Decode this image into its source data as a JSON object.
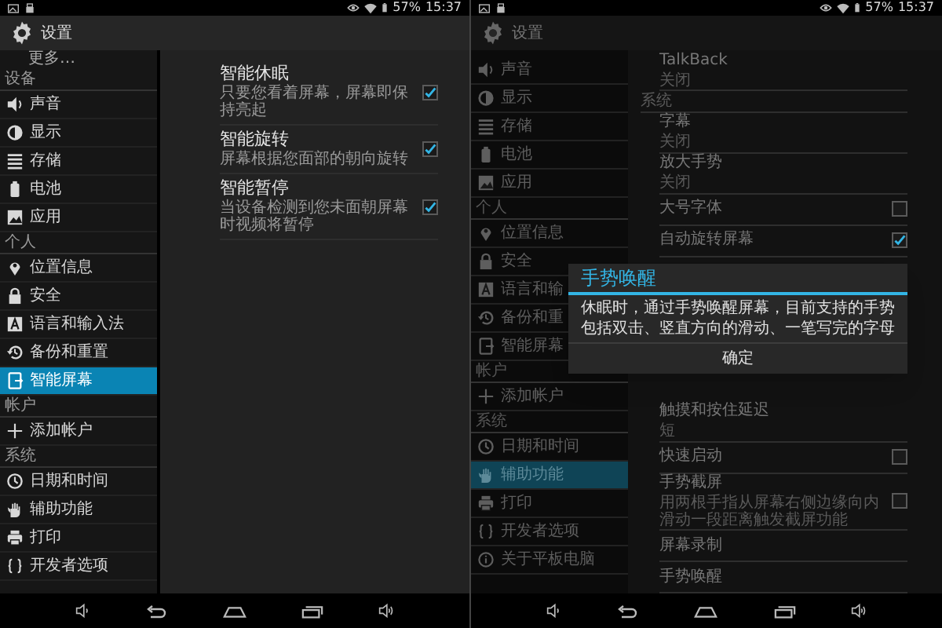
{
  "screens": [
    {
      "status_bar": {
        "battery": "57%",
        "time": "15:37"
      },
      "action_bar": {
        "title": "设置"
      },
      "sidebar": [
        {
          "kind": "cut",
          "label": "更多…"
        },
        {
          "kind": "header",
          "label": "设备"
        },
        {
          "kind": "item",
          "label": "声音",
          "selected": false
        },
        {
          "kind": "item",
          "label": "显示",
          "selected": false
        },
        {
          "kind": "item",
          "label": "存储",
          "selected": false
        },
        {
          "kind": "item",
          "label": "电池",
          "selected": false
        },
        {
          "kind": "item",
          "label": "应用",
          "selected": false
        },
        {
          "kind": "header",
          "label": "个人"
        },
        {
          "kind": "item",
          "label": "位置信息",
          "selected": false
        },
        {
          "kind": "item",
          "label": "安全",
          "selected": false
        },
        {
          "kind": "item",
          "label": "语言和输入法",
          "selected": false
        },
        {
          "kind": "item",
          "label": "备份和重置",
          "selected": false
        },
        {
          "kind": "item",
          "label": "智能屏幕",
          "selected": true
        },
        {
          "kind": "header",
          "label": "帐户"
        },
        {
          "kind": "item",
          "label": "添加帐户",
          "selected": false
        },
        {
          "kind": "header",
          "label": "系统"
        },
        {
          "kind": "item",
          "label": "日期和时间",
          "selected": false
        },
        {
          "kind": "item",
          "label": "辅助功能",
          "selected": false
        },
        {
          "kind": "item",
          "label": "打印",
          "selected": false
        },
        {
          "kind": "item",
          "label": "开发者选项",
          "selected": false
        }
      ],
      "content": {
        "rows": [
          {
            "kind": "checkbox",
            "title": "智能休眠",
            "subtitle": "只要您看着屏幕，屏幕即保持亮起",
            "checked": true
          },
          {
            "kind": "checkbox",
            "title": "智能旋转",
            "subtitle": "屏幕根据您面部的朝向旋转",
            "checked": true
          },
          {
            "kind": "checkbox",
            "title": "智能暂停",
            "subtitle": "当设备检测到您未面朝屏幕时视频将暂停",
            "checked": true
          }
        ]
      }
    },
    {
      "status_bar": {
        "battery": "57%",
        "time": "15:37"
      },
      "action_bar": {
        "title": "设置"
      },
      "sidebar": [
        {
          "kind": "item",
          "label": "声音",
          "selected": false
        },
        {
          "kind": "item",
          "label": "显示",
          "selected": false
        },
        {
          "kind": "item",
          "label": "存储",
          "selected": false
        },
        {
          "kind": "item",
          "label": "电池",
          "selected": false
        },
        {
          "kind": "item",
          "label": "应用",
          "selected": false
        },
        {
          "kind": "header",
          "label": "个人"
        },
        {
          "kind": "item",
          "label": "位置信息",
          "selected": false
        },
        {
          "kind": "item",
          "label": "安全",
          "selected": false
        },
        {
          "kind": "item",
          "label": "语言和输",
          "selected": false
        },
        {
          "kind": "item",
          "label": "备份和重",
          "selected": false
        },
        {
          "kind": "item",
          "label": "智能屏幕",
          "selected": false
        },
        {
          "kind": "header",
          "label": "帐户"
        },
        {
          "kind": "item",
          "label": "添加帐户",
          "selected": false
        },
        {
          "kind": "header",
          "label": "系统"
        },
        {
          "kind": "item",
          "label": "日期和时间",
          "selected": false
        },
        {
          "kind": "item",
          "label": "辅助功能",
          "selected": true
        },
        {
          "kind": "item",
          "label": "打印",
          "selected": false
        },
        {
          "kind": "item",
          "label": "开发者选项",
          "selected": false
        },
        {
          "kind": "item",
          "label": "关于平板电脑",
          "selected": false
        }
      ],
      "content": {
        "rows": [
          {
            "kind": "text",
            "title": "TalkBack",
            "subtitle": "关闭"
          },
          {
            "kind": "header",
            "title": "系统"
          },
          {
            "kind": "text",
            "title": "字幕",
            "subtitle": "关闭"
          },
          {
            "kind": "text",
            "title": "放大手势",
            "subtitle": "关闭"
          },
          {
            "kind": "checkbox",
            "title": "大号字体",
            "checked": false
          },
          {
            "kind": "checkbox",
            "title": "自动旋转屏幕",
            "checked": true
          }
        ],
        "rows_below_dialog": [
          {
            "kind": "text",
            "title": "触摸和按住延迟",
            "subtitle": "短"
          },
          {
            "kind": "checkbox",
            "title": "快速启动",
            "checked": false
          },
          {
            "kind": "checkbox",
            "title": "手势截屏",
            "subtitle": "用两根手指从屏幕右侧边缘向内滑动一段距离触发截屏功能",
            "checked": false
          },
          {
            "kind": "text",
            "title": "屏幕录制"
          },
          {
            "kind": "text",
            "title": "手势唤醒"
          }
        ]
      },
      "dialog": {
        "title": "手势唤醒",
        "message": "休眠时，通过手势唤醒屏幕，目前支持的手势包括双击、竖直方向的滑动、一笔写完的字母",
        "button": "确定"
      }
    }
  ]
}
